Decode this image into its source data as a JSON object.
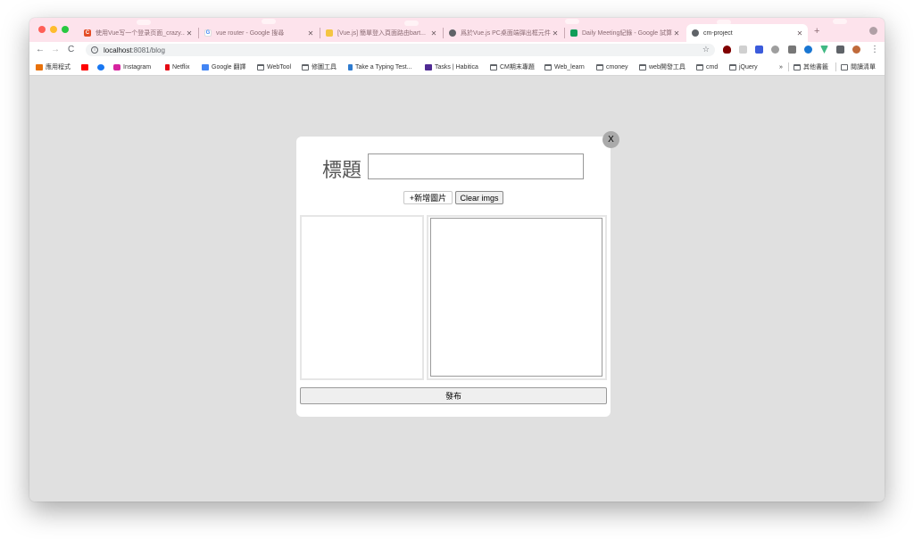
{
  "browser": {
    "tabs": [
      {
        "title": "使用Vue写一个登录页面_crazy...",
        "favicon_color": "#e44d26",
        "favicon_glyph": "C"
      },
      {
        "title": "vue router - Google 搜尋",
        "favicon_color": "#ffffff",
        "favicon_glyph": "G"
      },
      {
        "title": "[Vue.js] 簡單登入頁面路由bart...",
        "favicon_color": "#f4c542",
        "favicon_glyph": ""
      },
      {
        "title": "爲於Vue.js PC桌面端彈出框元件...",
        "favicon_color": "#5f6368",
        "favicon_glyph": ""
      },
      {
        "title": "Daily Meeting紀錄 - Google 試算...",
        "favicon_color": "#0f9d58",
        "favicon_glyph": ""
      },
      {
        "title": "cm-project",
        "favicon_color": "#5f6368",
        "favicon_glyph": ""
      }
    ],
    "new_tab_symbol": "+",
    "url_host": "localhost",
    "url_rest": ":8081/blog",
    "back_icon": "←",
    "forward_icon": "→",
    "reload_icon": "C",
    "star_icon": "☆",
    "menu_icon": "⋮"
  },
  "bookmarks": {
    "items": [
      {
        "label": "應用程式",
        "icon": "apps-icon",
        "color": "#e8710a"
      },
      {
        "label": "",
        "icon": "youtube-icon",
        "color": "#ff0000"
      },
      {
        "label": "",
        "icon": "facebook-icon",
        "color": "#1877f2"
      },
      {
        "label": "Instagram",
        "icon": "instagram-icon",
        "color": "#d6249f"
      },
      {
        "label": "Netflix",
        "icon": "netflix-icon",
        "color": "#e50914"
      },
      {
        "label": "Google 翻譯",
        "icon": "google-translate-icon",
        "color": "#4285f4"
      },
      {
        "label": "WebTool",
        "icon": "folder-icon",
        "color": ""
      },
      {
        "label": "修圖工具",
        "icon": "folder-icon",
        "color": ""
      },
      {
        "label": "Take a Typing Test...",
        "icon": "typing-test-icon",
        "color": "#2e7bcf"
      },
      {
        "label": "Tasks | Habitica",
        "icon": "habitica-icon",
        "color": "#4f2a93"
      },
      {
        "label": "CM期末專題",
        "icon": "folder-icon",
        "color": ""
      },
      {
        "label": "Web_learn",
        "icon": "folder-icon",
        "color": ""
      },
      {
        "label": "cmoney",
        "icon": "folder-icon",
        "color": ""
      },
      {
        "label": "web開發工具",
        "icon": "folder-icon",
        "color": ""
      },
      {
        "label": "cmd",
        "icon": "folder-icon",
        "color": ""
      },
      {
        "label": "jQuery",
        "icon": "folder-icon",
        "color": ""
      }
    ],
    "overflow": "»",
    "other": "其他書籤",
    "reading_list": "閱讀清單"
  },
  "modal": {
    "close_label": "X",
    "title_label": "標題",
    "title_value": "",
    "add_image_label": "+新增圖片",
    "clear_images_label": "Clear imgs",
    "publish_label": "發布"
  }
}
